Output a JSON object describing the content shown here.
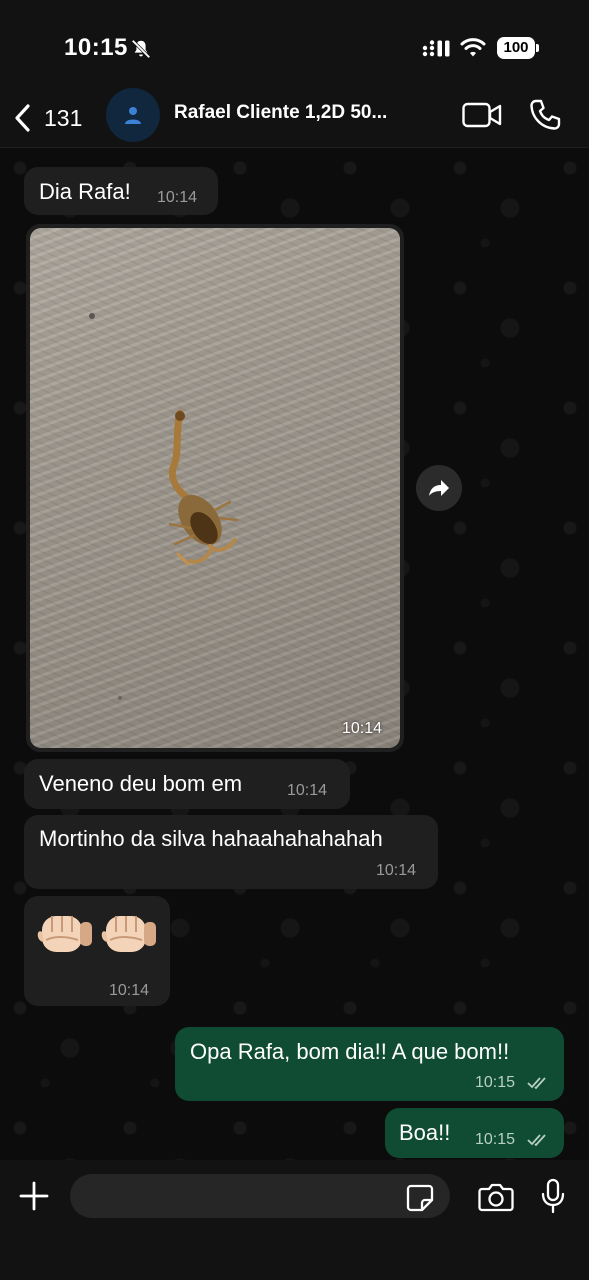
{
  "status_bar": {
    "time": "10:15",
    "battery": "100"
  },
  "header": {
    "back_count": "131",
    "contact_name": "Rafael Cliente 1,2D 50..."
  },
  "messages": [
    {
      "direction": "incoming",
      "type": "text",
      "text": "Dia Rafa!",
      "time": "10:14"
    },
    {
      "direction": "incoming",
      "type": "image",
      "time": "10:14"
    },
    {
      "direction": "incoming",
      "type": "text",
      "text": "Veneno deu bom em",
      "time": "10:14"
    },
    {
      "direction": "incoming",
      "type": "text",
      "text": "Mortinho da silva hahaahahahahah",
      "time": "10:14"
    },
    {
      "direction": "incoming",
      "type": "emoji",
      "text": "👊🏻👊🏻",
      "time": "10:14"
    },
    {
      "direction": "outgoing",
      "type": "text",
      "text": "Opa Rafa, bom dia!! A que bom!!",
      "time": "10:15",
      "status": "read"
    },
    {
      "direction": "outgoing",
      "type": "text",
      "text": "Boa!!",
      "time": "10:15",
      "status": "read"
    }
  ],
  "composer": {
    "value": "",
    "placeholder": ""
  },
  "colors": {
    "incoming_bubble": "#1f1f1f",
    "outgoing_bubble": "#0f4c33",
    "background": "#0b0b0b"
  },
  "icons": [
    "bell-off-icon",
    "signal-icon",
    "wifi-icon",
    "battery-icon",
    "chevron-left-icon",
    "person-icon",
    "video-icon",
    "phone-icon",
    "forward-icon",
    "plus-icon",
    "sticker-icon",
    "camera-icon",
    "mic-icon",
    "double-check-icon"
  ]
}
